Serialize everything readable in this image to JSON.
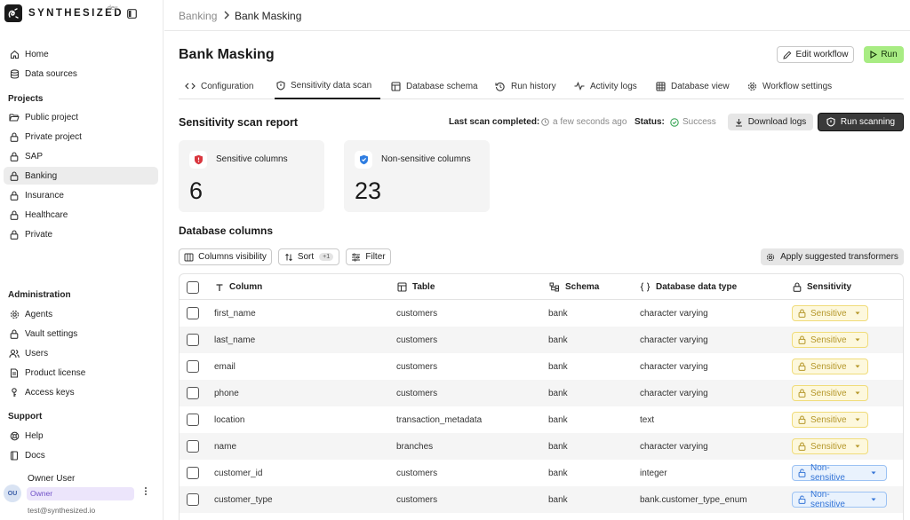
{
  "app": {
    "brand": "SYNTHESIZED",
    "env": "dev"
  },
  "sidebar": {
    "top": [
      {
        "label": "Home",
        "icon": "home-icon"
      },
      {
        "label": "Data sources",
        "icon": "database-icon"
      }
    ],
    "projects_title": "Projects",
    "projects": [
      {
        "label": "Public project",
        "icon": "folder-open-icon"
      },
      {
        "label": "Private project",
        "icon": "lock-icon"
      },
      {
        "label": "SAP",
        "icon": "lock-icon"
      },
      {
        "label": "Banking",
        "icon": "lock-icon",
        "active": true
      },
      {
        "label": "Insurance",
        "icon": "lock-icon"
      },
      {
        "label": "Healthcare",
        "icon": "lock-icon"
      },
      {
        "label": "Private",
        "icon": "lock-icon"
      }
    ],
    "admin_title": "Administration",
    "admin": [
      {
        "label": "Agents",
        "icon": "gear-icon"
      },
      {
        "label": "Vault settings",
        "icon": "lock-icon"
      },
      {
        "label": "Users",
        "icon": "users-icon"
      },
      {
        "label": "Product license",
        "icon": "document-icon"
      },
      {
        "label": "Access keys",
        "icon": "key-icon"
      }
    ],
    "support_title": "Support",
    "support": [
      {
        "label": "Help",
        "icon": "lifebuoy-icon"
      },
      {
        "label": "Docs",
        "icon": "docs-icon"
      }
    ],
    "user": {
      "initials": "OU",
      "name": "Owner User",
      "role": "Owner",
      "email": "test@synthesized.io"
    }
  },
  "header": {
    "breadcrumb_parent": "Banking",
    "breadcrumb_current": "Bank Masking"
  },
  "page": {
    "title": "Bank Masking",
    "edit_label": "Edit workflow",
    "run_label": "Run",
    "tabs": [
      {
        "label": "Configuration",
        "icon": "code-icon"
      },
      {
        "label": "Sensitivity data scan",
        "icon": "shield-icon",
        "active": true
      },
      {
        "label": "Database schema",
        "icon": "table-icon"
      },
      {
        "label": "Run history",
        "icon": "history-icon"
      },
      {
        "label": "Activity logs",
        "icon": "activity-icon"
      },
      {
        "label": "Database view",
        "icon": "grid-icon"
      },
      {
        "label": "Workflow settings",
        "icon": "gear-icon"
      }
    ]
  },
  "report": {
    "title": "Sensitivity scan report",
    "last_scan_label": "Last scan completed:",
    "last_scan_value": "a few seconds ago",
    "status_label": "Status:",
    "status_value": "Success",
    "download_label": "Download logs",
    "scan_label": "Run scanning",
    "sensitive_label": "Sensitive columns",
    "sensitive_value": "6",
    "nonsensitive_label": "Non-sensitive columns",
    "nonsensitive_value": "23"
  },
  "columns_section": {
    "title": "Database columns",
    "visibility_label": "Columns visibility",
    "sort_label": "Sort",
    "sort_count": "+1",
    "filter_label": "Filter",
    "apply_label": "Apply suggested transformers"
  },
  "table": {
    "headers": {
      "column": "Column",
      "table": "Table",
      "schema": "Schema",
      "type": "Database data type",
      "sensitivity": "Sensitivity"
    },
    "rows": [
      {
        "column": "first_name",
        "table": "customers",
        "schema": "bank",
        "type": "character varying",
        "sensitivity": "Sensitive"
      },
      {
        "column": "last_name",
        "table": "customers",
        "schema": "bank",
        "type": "character varying",
        "sensitivity": "Sensitive"
      },
      {
        "column": "email",
        "table": "customers",
        "schema": "bank",
        "type": "character varying",
        "sensitivity": "Sensitive"
      },
      {
        "column": "phone",
        "table": "customers",
        "schema": "bank",
        "type": "character varying",
        "sensitivity": "Sensitive"
      },
      {
        "column": "location",
        "table": "transaction_metadata",
        "schema": "bank",
        "type": "text",
        "sensitivity": "Sensitive"
      },
      {
        "column": "name",
        "table": "branches",
        "schema": "bank",
        "type": "character varying",
        "sensitivity": "Sensitive"
      },
      {
        "column": "customer_id",
        "table": "customers",
        "schema": "bank",
        "type": "integer",
        "sensitivity": "Non-sensitive"
      },
      {
        "column": "customer_type",
        "table": "customers",
        "schema": "bank",
        "type": "bank.customer_type_enum",
        "sensitivity": "Non-sensitive"
      }
    ]
  },
  "colors": {
    "run": "#a8ec83",
    "sensitive": "#b5972a",
    "non_sensitive": "#3474d6",
    "success": "#3aa757",
    "owner_badge": "#ece5fb"
  }
}
